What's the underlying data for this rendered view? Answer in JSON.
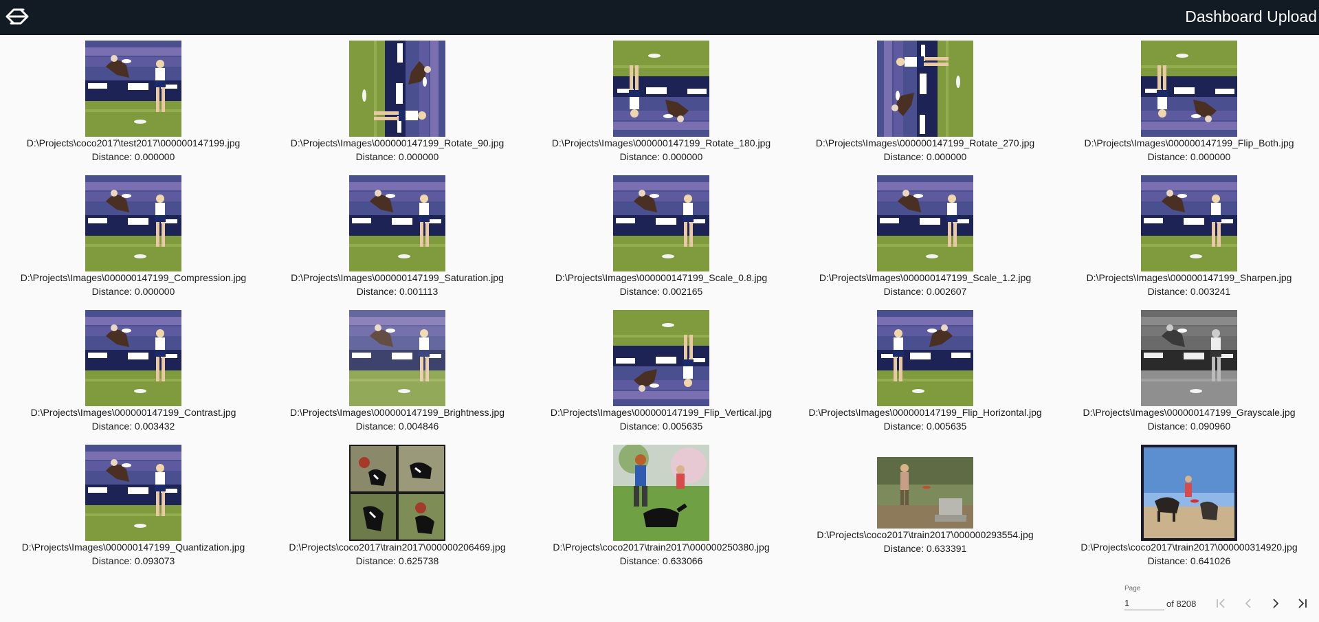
{
  "header": {
    "title": "Dashboard Upload",
    "logo_icon": "swap-arrows-logo-icon",
    "background": "#121b24"
  },
  "results": [
    {
      "path": "D:\\Projects\\coco2017\\test2017\\000000147199.jpg",
      "distance": "Distance: 0.000000",
      "variant": "original"
    },
    {
      "path": "D:\\Projects\\Images\\000000147199_Rotate_90.jpg",
      "distance": "Distance: 0.000000",
      "variant": "rotate90"
    },
    {
      "path": "D:\\Projects\\Images\\000000147199_Rotate_180.jpg",
      "distance": "Distance: 0.000000",
      "variant": "rotate180"
    },
    {
      "path": "D:\\Projects\\Images\\000000147199_Rotate_270.jpg",
      "distance": "Distance: 0.000000",
      "variant": "rotate270"
    },
    {
      "path": "D:\\Projects\\Images\\000000147199_Flip_Both.jpg",
      "distance": "Distance: 0.000000",
      "variant": "flipboth"
    },
    {
      "path": "D:\\Projects\\Images\\000000147199_Compression.jpg",
      "distance": "Distance: 0.000000",
      "variant": "original"
    },
    {
      "path": "D:\\Projects\\Images\\000000147199_Saturation.jpg",
      "distance": "Distance: 0.001113",
      "variant": "original"
    },
    {
      "path": "D:\\Projects\\Images\\000000147199_Scale_0.8.jpg",
      "distance": "Distance: 0.002165",
      "variant": "original"
    },
    {
      "path": "D:\\Projects\\Images\\000000147199_Scale_1.2.jpg",
      "distance": "Distance: 0.002607",
      "variant": "original"
    },
    {
      "path": "D:\\Projects\\Images\\000000147199_Sharpen.jpg",
      "distance": "Distance: 0.003241",
      "variant": "original"
    },
    {
      "path": "D:\\Projects\\Images\\000000147199_Contrast.jpg",
      "distance": "Distance: 0.003432",
      "variant": "original"
    },
    {
      "path": "D:\\Projects\\Images\\000000147199_Brightness.jpg",
      "distance": "Distance: 0.004846",
      "variant": "bright"
    },
    {
      "path": "D:\\Projects\\Images\\000000147199_Flip_Vertical.jpg",
      "distance": "Distance: 0.005635",
      "variant": "flipv"
    },
    {
      "path": "D:\\Projects\\Images\\000000147199_Flip_Horizontal.jpg",
      "distance": "Distance: 0.005635",
      "variant": "fliph"
    },
    {
      "path": "D:\\Projects\\Images\\000000147199_Grayscale.jpg",
      "distance": "Distance: 0.090960",
      "variant": "gray"
    },
    {
      "path": "D:\\Projects\\Images\\000000147199_Quantization.jpg",
      "distance": "Distance: 0.093073",
      "variant": "original"
    },
    {
      "path": "D:\\Projects\\coco2017\\train2017\\000000206469.jpg",
      "distance": "Distance: 0.625738",
      "variant": "dogs-collage"
    },
    {
      "path": "D:\\Projects\\coco2017\\train2017\\000000250380.jpg",
      "distance": "Distance: 0.633066",
      "variant": "park-dog"
    },
    {
      "path": "D:\\Projects\\coco2017\\train2017\\000000293554.jpg",
      "distance": "Distance: 0.633391",
      "variant": "yard"
    },
    {
      "path": "D:\\Projects\\coco2017\\train2017\\000000314920.jpg",
      "distance": "Distance: 0.641026",
      "variant": "beach"
    }
  ],
  "paginator": {
    "label": "Page",
    "value": "1",
    "total_label": "of 8208",
    "first_icon": "first-page-icon",
    "prev_icon": "chevron-left-icon",
    "next_icon": "chevron-right-icon",
    "last_icon": "last-page-icon"
  }
}
